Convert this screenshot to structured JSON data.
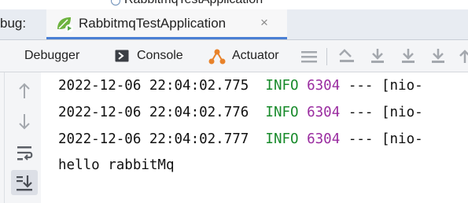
{
  "top_window": {
    "title": "RabbitmqTestApplication"
  },
  "debug_bar": {
    "label": "bug:",
    "run_tab": {
      "name": "RabbitmqTestApplication",
      "icon": "spring-run-icon",
      "close": "×"
    }
  },
  "toolbar": {
    "tabs": [
      {
        "label": "Debugger"
      },
      {
        "label": "Console",
        "icon": "console-icon",
        "active": true
      },
      {
        "label": "Actuator",
        "icon": "actuator-icon"
      }
    ],
    "icons": [
      "menu-icon",
      "show-execution-point-icon",
      "step-over-icon",
      "step-into-icon",
      "force-step-into-icon",
      "step-out-icon"
    ]
  },
  "sidebar": {
    "buttons": [
      "scroll-up-icon",
      "scroll-down-icon",
      "soft-wrap-icon",
      "scroll-to-end-icon"
    ]
  },
  "console": {
    "lines": [
      {
        "timestamp": "2022-12-06 22:04:02.775",
        "level": "INFO",
        "pid": "6304",
        "rest": "--- [nio-"
      },
      {
        "timestamp": "2022-12-06 22:04:02.776",
        "level": "INFO",
        "pid": "6304",
        "rest": "--- [nio-"
      },
      {
        "timestamp": "2022-12-06 22:04:02.777",
        "level": "INFO",
        "pid": "6304",
        "rest": "--- [nio-"
      }
    ],
    "output": "hello rabbitMq"
  },
  "colors": {
    "info": "#178a2a",
    "pid": "#9a2ca0",
    "accent": "#4a7fd4"
  }
}
